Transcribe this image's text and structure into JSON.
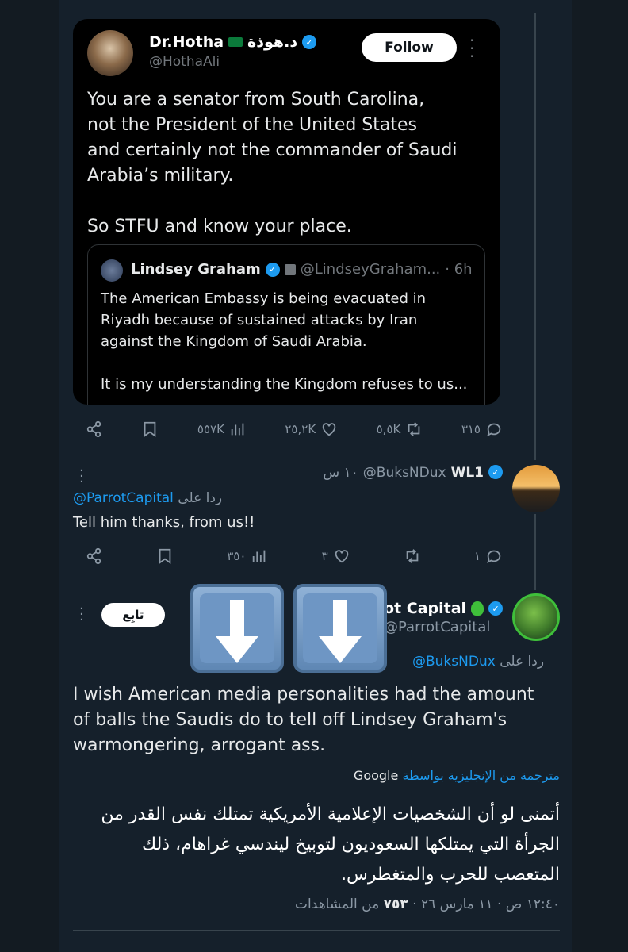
{
  "embedded_tweet": {
    "name": "Dr.Hotha",
    "name_suffix": "د.هوذة",
    "handle": "@HothaAli",
    "follow_label": "Follow",
    "body": "You are a senator from South Carolina,\nnot the President of the United States\nand certainly not the commander of Saudi\nArabia’s military.\n\nSo STFU and know your place.",
    "quote": {
      "name": "Lindsey Graham",
      "handle": "@LindseyGraham...",
      "time": "· 6h",
      "body": "The American Embassy is being evacuated in\nRiyadh because of sustained attacks by Iran\nagainst the Kingdom of Saudi Arabia.\n\nIt is my understanding the Kingdom refuses to us..."
    }
  },
  "tweet_actions": {
    "views": "٥٥٧K",
    "likes": "٢٥,٢K",
    "retweets": "٥,٥K",
    "replies": "٣١٥"
  },
  "reply1": {
    "name": "WL1",
    "handle": "@BuksNDux",
    "time": "١٠ س",
    "reply_prefix": "ردا على",
    "reply_to": "@ParrotCapital",
    "text": "Tell him thanks, from us!!",
    "views": "٣٥٠",
    "likes": "٣",
    "replies": "١"
  },
  "reply2": {
    "name": "ot Capital",
    "handle": "@ParrotCapital",
    "follow_label": "تابِع",
    "reply_prefix": "ردا على",
    "reply_to": "@BuksNDux",
    "text": "I wish American media personalities had the amount of balls the Saudis do to tell off Lindsey Graham's warmongering, arrogant ass.",
    "translated_label": "مترجمة من الإنجليزية بواسطة",
    "translated_by": "Google",
    "arabic_text": "أتمنى لو أن الشخصيات الإعلامية الأمريكية تمتلك نفس القدر من الجرأة التي يمتلكها السعوديون لتوبيخ ليندسي غراهام، ذلك المتعصب للحرب والمتغطرس.",
    "meta_time": "١٢:٤٠ ص · ١١ مارس ٢٦ ·",
    "meta_views": "٧٥٣",
    "meta_views_label": "من المشاهدات"
  },
  "colors": {
    "background": "#15202b",
    "accent": "#1d9bf0",
    "muted": "#8b98a5"
  }
}
